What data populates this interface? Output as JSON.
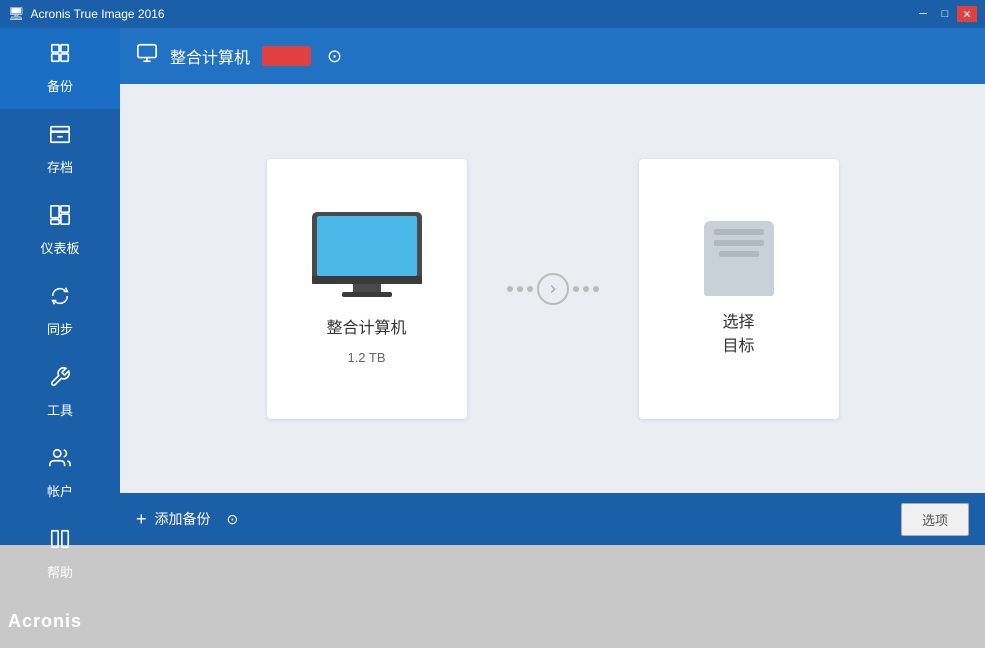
{
  "titlebar": {
    "title": "Acronis True Image 2016",
    "icon": "💿",
    "controls": {
      "minimize": "─",
      "maximize": "□",
      "close": "✕"
    }
  },
  "sidebar": {
    "items": [
      {
        "id": "backup",
        "label": "备份",
        "icon": "backup",
        "active": true
      },
      {
        "id": "archive",
        "label": "存档",
        "icon": "archive",
        "active": false
      },
      {
        "id": "dashboard",
        "label": "仪表板",
        "icon": "dashboard",
        "active": false
      },
      {
        "id": "sync",
        "label": "同步",
        "icon": "sync",
        "active": false
      },
      {
        "id": "tools",
        "label": "工具",
        "icon": "tools",
        "active": false
      },
      {
        "id": "account",
        "label": "帐户",
        "icon": "account",
        "active": false
      },
      {
        "id": "help",
        "label": "帮助",
        "icon": "help",
        "active": false
      }
    ],
    "logo": "Acronis"
  },
  "topbar": {
    "icon": "monitor",
    "title": "整合计算机",
    "badge": "",
    "chevron": "⊙"
  },
  "source_card": {
    "title": "整合计算机",
    "subtitle": "1.2 TB"
  },
  "target_card": {
    "line1": "选择",
    "line2": "目标"
  },
  "bottombar": {
    "plus": "+",
    "label": "添加备份",
    "chevron": "⊙",
    "options_btn": "选项"
  },
  "colors": {
    "sidebar_bg": "#1a5fa8",
    "topbar_bg": "#2272c3",
    "content_bg": "#eaeef2",
    "card_bg": "#ffffff",
    "badge_bg": "#e04040"
  }
}
